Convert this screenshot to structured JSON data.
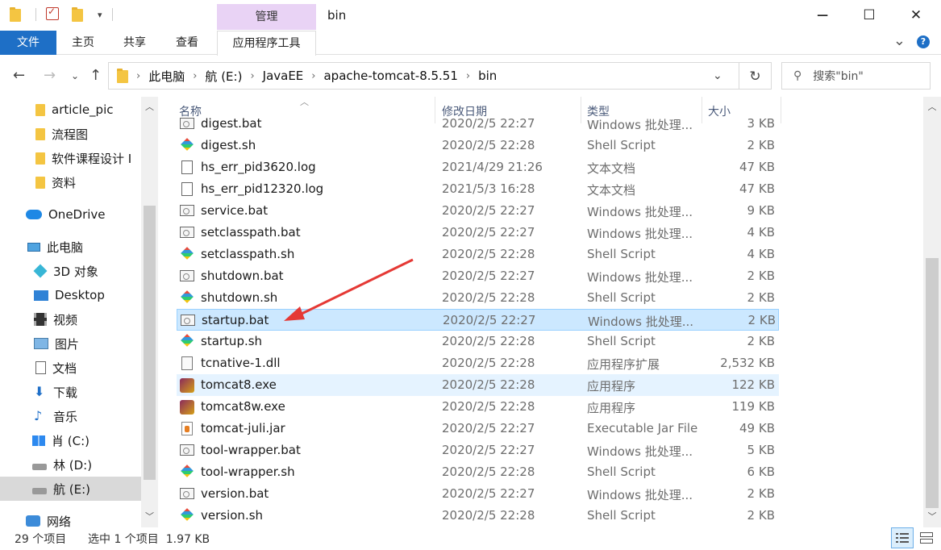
{
  "window": {
    "title": "bin",
    "context_tab": "管理",
    "minimize": "─",
    "maximize": "☐",
    "close": "✕"
  },
  "ribbon": {
    "tabs": [
      "文件",
      "主页",
      "共享",
      "查看",
      "应用程序工具"
    ],
    "collapse": "⌄",
    "help": "?"
  },
  "address": {
    "crumbs": [
      "此电脑",
      "航 (E:)",
      "JavaEE",
      "apache-tomcat-8.5.51",
      "bin"
    ],
    "search_placeholder": "搜索\"bin\""
  },
  "nav": {
    "items": [
      {
        "label": "article_pic",
        "icon": "folder-icon"
      },
      {
        "label": "流程图",
        "icon": "folder-icon"
      },
      {
        "label": "软件课程设计 I",
        "icon": "folder-icon"
      },
      {
        "label": "资料",
        "icon": "folder-icon"
      },
      {
        "label": "OneDrive",
        "icon": "onedrive-icon"
      },
      {
        "label": "此电脑",
        "icon": "this-pc-icon"
      },
      {
        "label": "3D 对象",
        "icon": "3d-objects-icon"
      },
      {
        "label": "Desktop",
        "icon": "desktop-icon"
      },
      {
        "label": "视频",
        "icon": "video-icon"
      },
      {
        "label": "图片",
        "icon": "pictures-icon"
      },
      {
        "label": "文档",
        "icon": "documents-icon"
      },
      {
        "label": "下载",
        "icon": "download-icon"
      },
      {
        "label": "音乐",
        "icon": "music-icon"
      },
      {
        "label": "肖 (C:)",
        "icon": "windows-drive-icon"
      },
      {
        "label": "林 (D:)",
        "icon": "drive-icon"
      },
      {
        "label": "航 (E:)",
        "icon": "drive-icon"
      },
      {
        "label": "网络",
        "icon": "network-icon"
      }
    ]
  },
  "columns": [
    "名称",
    "修改日期",
    "类型",
    "大小"
  ],
  "files": [
    {
      "name": "digest.bat",
      "date": "2020/2/5 22:27",
      "type": "Windows 批处理...",
      "size": "3 KB",
      "icon": "bat"
    },
    {
      "name": "digest.sh",
      "date": "2020/2/5 22:28",
      "type": "Shell Script",
      "size": "2 KB",
      "icon": "sh"
    },
    {
      "name": "hs_err_pid3620.log",
      "date": "2021/4/29 21:26",
      "type": "文本文档",
      "size": "47 KB",
      "icon": "txt"
    },
    {
      "name": "hs_err_pid12320.log",
      "date": "2021/5/3 16:28",
      "type": "文本文档",
      "size": "47 KB",
      "icon": "txt"
    },
    {
      "name": "service.bat",
      "date": "2020/2/5 22:27",
      "type": "Windows 批处理...",
      "size": "9 KB",
      "icon": "bat"
    },
    {
      "name": "setclasspath.bat",
      "date": "2020/2/5 22:27",
      "type": "Windows 批处理...",
      "size": "4 KB",
      "icon": "bat"
    },
    {
      "name": "setclasspath.sh",
      "date": "2020/2/5 22:28",
      "type": "Shell Script",
      "size": "4 KB",
      "icon": "sh"
    },
    {
      "name": "shutdown.bat",
      "date": "2020/2/5 22:27",
      "type": "Windows 批处理...",
      "size": "2 KB",
      "icon": "bat"
    },
    {
      "name": "shutdown.sh",
      "date": "2020/2/5 22:28",
      "type": "Shell Script",
      "size": "2 KB",
      "icon": "sh"
    },
    {
      "name": "startup.bat",
      "date": "2020/2/5 22:27",
      "type": "Windows 批处理...",
      "size": "2 KB",
      "icon": "bat",
      "selected": true
    },
    {
      "name": "startup.sh",
      "date": "2020/2/5 22:28",
      "type": "Shell Script",
      "size": "2 KB",
      "icon": "sh"
    },
    {
      "name": "tcnative-1.dll",
      "date": "2020/2/5 22:28",
      "type": "应用程序扩展",
      "size": "2,532 KB",
      "icon": "dll"
    },
    {
      "name": "tomcat8.exe",
      "date": "2020/2/5 22:28",
      "type": "应用程序",
      "size": "122 KB",
      "icon": "exe",
      "hover": true
    },
    {
      "name": "tomcat8w.exe",
      "date": "2020/2/5 22:28",
      "type": "应用程序",
      "size": "119 KB",
      "icon": "exe"
    },
    {
      "name": "tomcat-juli.jar",
      "date": "2020/2/5 22:27",
      "type": "Executable Jar File",
      "size": "49 KB",
      "icon": "jar"
    },
    {
      "name": "tool-wrapper.bat",
      "date": "2020/2/5 22:27",
      "type": "Windows 批处理...",
      "size": "5 KB",
      "icon": "bat"
    },
    {
      "name": "tool-wrapper.sh",
      "date": "2020/2/5 22:28",
      "type": "Shell Script",
      "size": "6 KB",
      "icon": "sh"
    },
    {
      "name": "version.bat",
      "date": "2020/2/5 22:27",
      "type": "Windows 批处理...",
      "size": "2 KB",
      "icon": "bat"
    },
    {
      "name": "version.sh",
      "date": "2020/2/5 22:28",
      "type": "Shell Script",
      "size": "2 KB",
      "icon": "sh"
    }
  ],
  "status": {
    "count": "29 个项目",
    "selection": "选中 1 个项目  1.97 KB"
  },
  "annotation": {
    "color": "#e53935"
  }
}
